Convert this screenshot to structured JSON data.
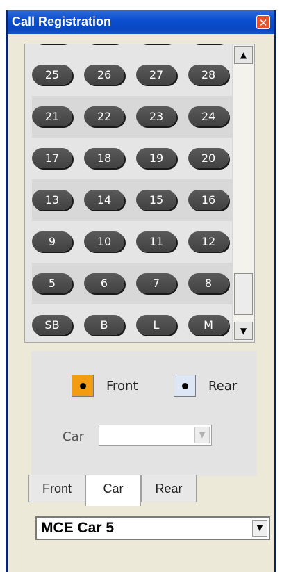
{
  "window": {
    "title": "Call Registration",
    "close_icon": "close-icon",
    "accent": "#0b4fd1"
  },
  "floors": {
    "rows": [
      [
        "25",
        "26",
        "27",
        "28"
      ],
      [
        "21",
        "22",
        "23",
        "24"
      ],
      [
        "17",
        "18",
        "19",
        "20"
      ],
      [
        "13",
        "14",
        "15",
        "16"
      ],
      [
        "9",
        "10",
        "11",
        "12"
      ],
      [
        "5",
        "6",
        "7",
        "8"
      ],
      [
        "SB",
        "B",
        "L",
        "M"
      ]
    ],
    "scroll_up_icon": "arrow-up-icon",
    "scroll_down_icon": "arrow-down-icon"
  },
  "doors": {
    "front_label": "Front",
    "rear_label": "Rear",
    "front_color": "#f39c12",
    "rear_color": "#dde6f5",
    "car_label": "Car",
    "car_value": ""
  },
  "tabs": [
    {
      "label": "Front"
    },
    {
      "label": "Car",
      "active": true
    },
    {
      "label": "Rear"
    }
  ],
  "car_select": {
    "value": "MCE Car 5"
  }
}
